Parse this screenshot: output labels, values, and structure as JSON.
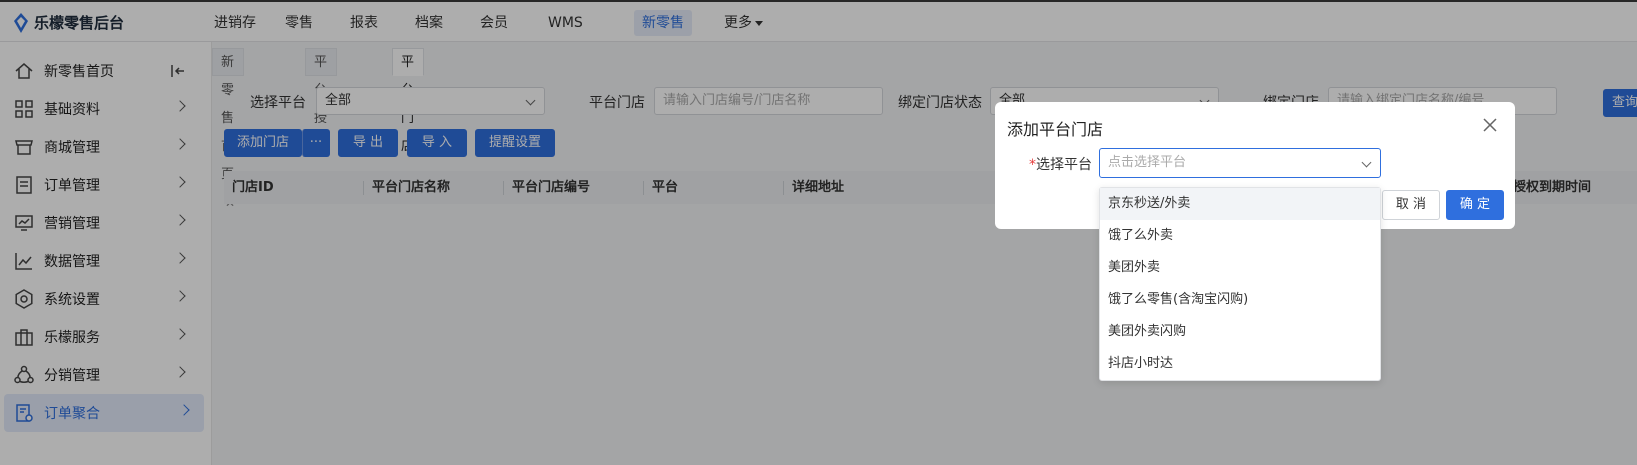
{
  "app": {
    "brand": "乐檬零售后台"
  },
  "topnav": {
    "items": [
      "进销存",
      "零售",
      "报表",
      "档案",
      "会员",
      "WMS",
      "新零售",
      "更多"
    ],
    "active": "新零售"
  },
  "sidebar": {
    "items": [
      {
        "label": "新零售首页",
        "icon": "home-icon"
      },
      {
        "label": "基础资料",
        "icon": "grid-icon"
      },
      {
        "label": "商城管理",
        "icon": "store-icon"
      },
      {
        "label": "订单管理",
        "icon": "document-icon"
      },
      {
        "label": "营销管理",
        "icon": "chart-screen-icon"
      },
      {
        "label": "数据管理",
        "icon": "line-chart-icon"
      },
      {
        "label": "系统设置",
        "icon": "settings-icon"
      },
      {
        "label": "乐檬服务",
        "icon": "briefcase-icon"
      },
      {
        "label": "分销管理",
        "icon": "share-icon"
      },
      {
        "label": "订单聚合",
        "icon": "order-aggregate-icon"
      }
    ],
    "active": "订单聚合"
  },
  "tabs": [
    {
      "label": "新零售首页"
    },
    {
      "label": "平台授权"
    },
    {
      "label": "平台门店"
    }
  ],
  "filters": {
    "platform_label": "选择平台",
    "platform_value": "全部",
    "store_label": "平台门店",
    "store_placeholder": "请输入门店编号/门店名称",
    "bind_status_label": "绑定门店状态",
    "bind_status_value": "全部",
    "bind_store_label": "绑定门店",
    "bind_store_placeholder": "请输入绑定门店名称/编号",
    "search_button": "查询"
  },
  "actions": {
    "add_store": "添加门店",
    "more": "···",
    "export": "导 出",
    "import": "导 入",
    "reminder": "提醒设置"
  },
  "table": {
    "columns": [
      "门店ID",
      "平台门店名称",
      "平台门店编号",
      "平台",
      "详细地址",
      "授权到期时间"
    ]
  },
  "modal": {
    "title": "添加平台门店",
    "field_label": "选择平台",
    "field_placeholder": "点击选择平台",
    "cancel": "取 消",
    "ok": "确 定"
  },
  "dropdown": {
    "options": [
      "京东秒送/外卖",
      "饿了么外卖",
      "美团外卖",
      "饿了么零售(含淘宝闪购)",
      "美团外卖闪购",
      "抖店小时达"
    ],
    "hovered_index": 0
  },
  "colors": {
    "primary": "#2f6fde",
    "required": "#e43c3c"
  }
}
